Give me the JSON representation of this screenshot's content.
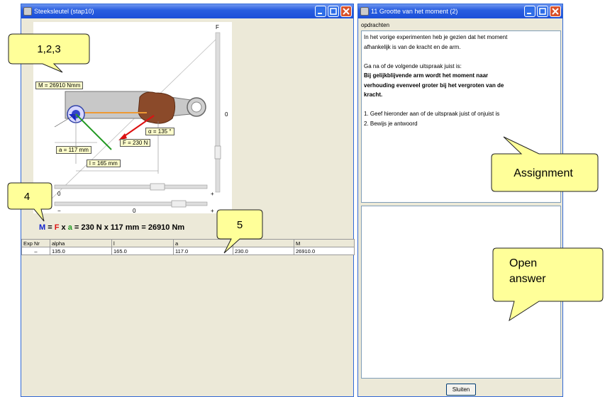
{
  "left_window": {
    "title": "Steeksleutel (stap10)",
    "scale_f_label": "F",
    "scale_f_value": "0",
    "slider1_left": "0",
    "slider1_plus": "+",
    "slider2_minus": "−",
    "slider2_mid": "0",
    "slider2_plus": "+",
    "label_M": "M = 26910  Nmm",
    "label_alpha": "α = 135 °",
    "label_F": "F = 230 N",
    "label_a": "a = 117 mm",
    "label_l": "l = 165 mm",
    "formula": {
      "M": "M",
      "eq1": " = ",
      "F": "F",
      "x1": " x ",
      "a": "a",
      "rest": " = 230 N  x  117 mm = 26910 Nm"
    },
    "table": {
      "headers": [
        "Exp Nr",
        "alpha",
        "l",
        "a",
        "",
        "M"
      ],
      "rows": [
        [
          "–",
          "135.0",
          "165.0",
          "117.0",
          "230.0",
          "26910.0"
        ]
      ]
    }
  },
  "right_window": {
    "title": "11  Grootte van het moment (2)",
    "section_label": "opdrachten",
    "lines": [
      "In het vorige experimenten heb je gezien dat het moment",
      "afhankelijk is van de kracht en de arm.",
      "",
      "Ga na of de volgende uitspraak juist is:",
      "Bij gelijkblijvende arm wordt het moment naar",
      "verhouding evenveel groter bij het vergroten van de",
      "kracht.",
      "",
      "1. Geef hieronder aan of de uitspraak juist of onjuist is",
      "2. Bewijs je antwoord"
    ],
    "close_button": "Sluiten"
  },
  "callouts": {
    "c123": "1,2,3",
    "c4": "4",
    "c5": "5",
    "assignment": "Assignment",
    "open_line1": "Open",
    "open_line2": "answer"
  },
  "colors": {
    "callout_fill": "#ffff99",
    "arrow_red": "#dd1111",
    "arm_green": "#229922",
    "moment_blue": "#1122cc",
    "title_blue": "#2a5fe0"
  }
}
